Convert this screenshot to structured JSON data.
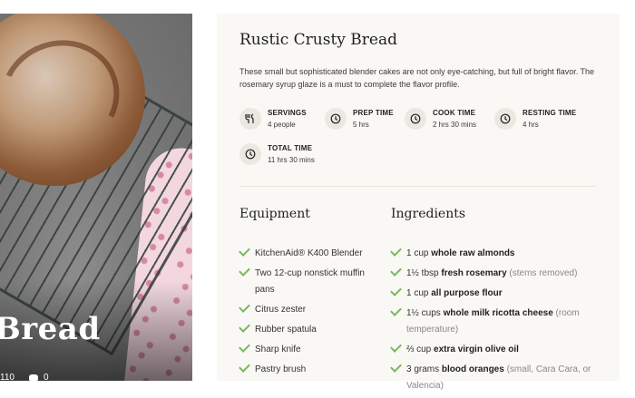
{
  "hero": {
    "title": "Bread",
    "views": "110",
    "comments": "0"
  },
  "recipe": {
    "title": "Rustic Crusty Bread",
    "description": "These small but sophisticated blender cakes are not only eye-catching, but full of bright flavor. The rosemary syrup glaze is a must to complete the flavor profile.",
    "facts": [
      {
        "label": "SERVINGS",
        "value": "4 people",
        "icon": "fork-knife-icon"
      },
      {
        "label": "PREP TIME",
        "value": "5 hrs",
        "icon": "clock-icon"
      },
      {
        "label": "COOK TIME",
        "value": "2 hrs 30 mins",
        "icon": "clock-icon"
      },
      {
        "label": "RESTING TIME",
        "value": "4 hrs",
        "icon": "clock-icon"
      },
      {
        "label": "TOTAL TIME",
        "value": "11 hrs 30 mins",
        "icon": "clock-icon"
      }
    ],
    "equipment_title": "Equipment",
    "equipment": [
      "KitchenAid® K400 Blender",
      "Two 12-cup nonstick muffin pans",
      "Citrus zester",
      "Rubber spatula",
      "Sharp knife",
      "Pastry brush"
    ],
    "ingredients_title": "Ingredients",
    "ingredients": [
      {
        "amount": "1 cup",
        "name": "whole raw almonds",
        "note": ""
      },
      {
        "amount": "1½ tbsp",
        "name": "fresh rosemary",
        "note": "(stems removed)"
      },
      {
        "amount": "1 cup",
        "name": "all purpose flour",
        "note": ""
      },
      {
        "amount": "1½ cups",
        "name": "whole milk ricotta cheese",
        "note": "(room temperature)"
      },
      {
        "amount": "⅔ cup",
        "name": "extra virgin olive oil",
        "note": ""
      },
      {
        "amount": "3 grams",
        "name": "blood oranges",
        "note": "(small, Cara Cara, or Valencia)"
      }
    ]
  },
  "colors": {
    "accent_check": "#7ab85e",
    "card_bg": "#faf8f5"
  }
}
